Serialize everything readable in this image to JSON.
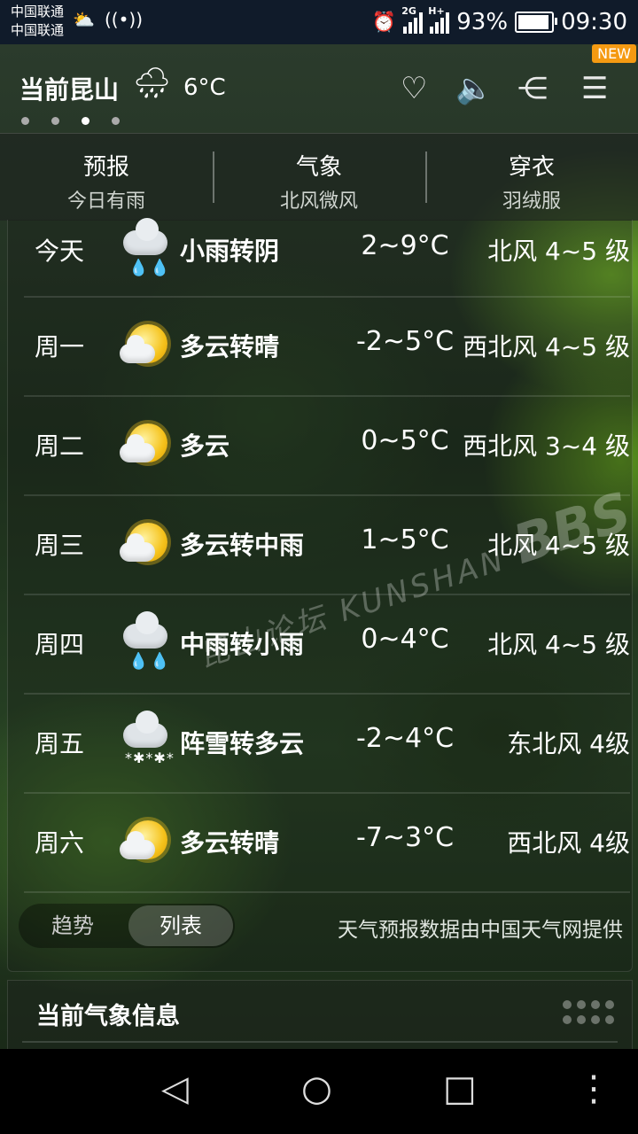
{
  "status_bar": {
    "carrier1": "中国联通",
    "carrier2": "中国联通",
    "network1": "2G",
    "network2": "H+",
    "battery": "93%",
    "battery_level": 0.93,
    "time": "09:30"
  },
  "header": {
    "city": "当前昆山",
    "temp": "6°C",
    "weather_icon": "rain-cloud-icon",
    "new_badge": "NEW",
    "page_dots": 4,
    "active_dot": 2
  },
  "tabs": [
    {
      "title": "预报",
      "subtitle": "今日有雨"
    },
    {
      "title": "气象",
      "subtitle": "北风微风"
    },
    {
      "title": "穿衣",
      "subtitle": "羽绒服"
    }
  ],
  "forecast": [
    {
      "day": "今天",
      "icon": "rain-cloud-icon",
      "desc": "小雨转阴",
      "temp": "2~9°C",
      "wind": "北风 4~5 级"
    },
    {
      "day": "周一",
      "icon": "partly-cloudy-icon",
      "desc": "多云转晴",
      "temp": "-2~5°C",
      "wind": "西北风 4~5 级"
    },
    {
      "day": "周二",
      "icon": "partly-cloudy-icon",
      "desc": "多云",
      "temp": "0~5°C",
      "wind": "西北风 3~4 级"
    },
    {
      "day": "周三",
      "icon": "partly-cloudy-icon",
      "desc": "多云转中雨",
      "temp": "1~5°C",
      "wind": "北风 4~5 级"
    },
    {
      "day": "周四",
      "icon": "rain-cloud-icon",
      "desc": "中雨转小雨",
      "temp": "0~4°C",
      "wind": "北风 4~5 级"
    },
    {
      "day": "周五",
      "icon": "snow-cloud-icon",
      "desc": "阵雪转多云",
      "temp": "-2~4°C",
      "wind": "东北风 4级"
    },
    {
      "day": "周六",
      "icon": "partly-cloudy-icon",
      "desc": "多云转晴",
      "temp": "-7~3°C",
      "wind": "西北风 4级"
    }
  ],
  "view_toggle": {
    "trend": "趋势",
    "list": "列表",
    "active": "list"
  },
  "data_source": "天气预报数据由中国天气网提供",
  "watermark": {
    "cn": "昆山论坛",
    "en": "KUNSHAN",
    "brand": "BBS"
  },
  "info_section": {
    "title": "当前气象信息"
  },
  "colors": {
    "badge": "#f59a12",
    "rain_drop": "#4aa6ff",
    "sun": "#f5c21b",
    "status_bar": "#101b2a"
  }
}
